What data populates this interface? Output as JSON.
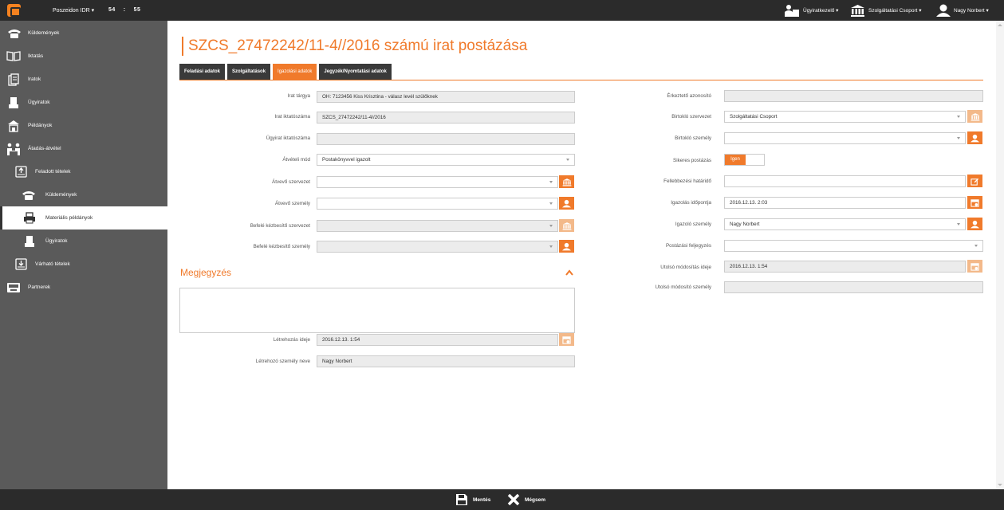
{
  "topbar": {
    "app_name": "Poszeidon IDR ▾",
    "clock_h": "54",
    "clock_sep": ":",
    "clock_m": "55",
    "user_role": "Ügyiratkezelő ▾",
    "org": "Szolgáltatási Csoport ▾",
    "user": "Nagy Norbert ▾"
  },
  "sidebar": {
    "items": [
      {
        "label": "Küldemények",
        "icon": "phone-icon"
      },
      {
        "label": "Iktatás",
        "icon": "book-icon"
      },
      {
        "label": "Iratok",
        "icon": "documents-icon"
      },
      {
        "label": "Ügyiratok",
        "icon": "folder-stack-icon"
      },
      {
        "label": "Példányok",
        "icon": "copies-icon"
      },
      {
        "label": "Átadás-átvétel",
        "icon": "handover-icon"
      },
      {
        "label": "Feladott tételek",
        "icon": "outbox-icon"
      },
      {
        "label": "Küldemények",
        "icon": "phone-icon"
      },
      {
        "label": "Materiális példányok",
        "icon": "printer-icon"
      },
      {
        "label": "Ügyiratok",
        "icon": "folder-stack-icon"
      },
      {
        "label": "Várható tételek",
        "icon": "inbox-icon"
      },
      {
        "label": "Partnerek",
        "icon": "partners-icon"
      }
    ]
  },
  "page": {
    "title": "SZCS_27472242/11-4//2016 számú irat postázása"
  },
  "tabs": [
    {
      "label": "Feladási adatok"
    },
    {
      "label": "Szolgáltatások"
    },
    {
      "label": "Igazolási adatok"
    },
    {
      "label": "Jegyzék/Nyomtatási adatok"
    }
  ],
  "left_form": {
    "irat_targya": {
      "label": "Irat tárgya",
      "value": "OH: 7123456 Kiss Krisztina - válasz levél szülőknek"
    },
    "irat_iktatoszama": {
      "label": "Irat iktatószáma",
      "value": "SZCS_27472242/11-4//2016"
    },
    "ugyirat_iktatoszama": {
      "label": "Ügyirat iktatószáma",
      "value": ""
    },
    "atveteli_mod": {
      "label": "Átvételi mód",
      "value": "Postakönyvvel igazolt"
    },
    "atvevo_szervezet": {
      "label": "Átvevő szervezet",
      "value": ""
    },
    "atvevo_szemely": {
      "label": "Átvevő személy",
      "value": ""
    },
    "befele_szervezet": {
      "label": "Befelé kézbesítő szervezet",
      "value": ""
    },
    "befele_szemely": {
      "label": "Befelé kézbesítő személy",
      "value": ""
    }
  },
  "megjegyzes": {
    "title": "Megjegyzés",
    "text": ""
  },
  "bottom_form": {
    "letrehozas_ideje": {
      "label": "Létrehozás ideje",
      "value": "2016.12.13. 1:54"
    },
    "letrehozo_neve": {
      "label": "Létrehozó személy neve",
      "value": "Nagy Norbert"
    }
  },
  "right_form": {
    "erkezteto": {
      "label": "Érkeztető azonosító",
      "value": ""
    },
    "birtoklo_szervezet": {
      "label": "Birtokló szervezet",
      "value": "Szolgáltatási Csoport"
    },
    "birtoklo_szemely": {
      "label": "Birtokló személy",
      "value": ""
    },
    "sikeres_postazas": {
      "label": "Sikeres postázás",
      "value": "Igen"
    },
    "fellebbezesi_hatarido": {
      "label": "Fellebbezési határidő",
      "value": ""
    },
    "igazolas_idopontja": {
      "label": "Igazolás időpontja",
      "value": "2016.12.13. 2:03"
    },
    "igazolo_szemely": {
      "label": "Igazoló személy",
      "value": "Nagy Norbert"
    },
    "postazasi_feljegyzes": {
      "label": "Postázási feljegyzés",
      "value": ""
    },
    "utolso_modositas_ideje": {
      "label": "Utolsó módosítás ideje",
      "value": "2016.12.13. 1:54"
    },
    "utolso_modosito": {
      "label": "Utolsó módosító személy",
      "value": ""
    }
  },
  "bottombar": {
    "save_label": "Mentés",
    "cancel_label": "Mégsem"
  },
  "colors": {
    "accent": "#f07a2b",
    "dark": "#2b2b2b",
    "sidebar": "#5a5a5a"
  }
}
